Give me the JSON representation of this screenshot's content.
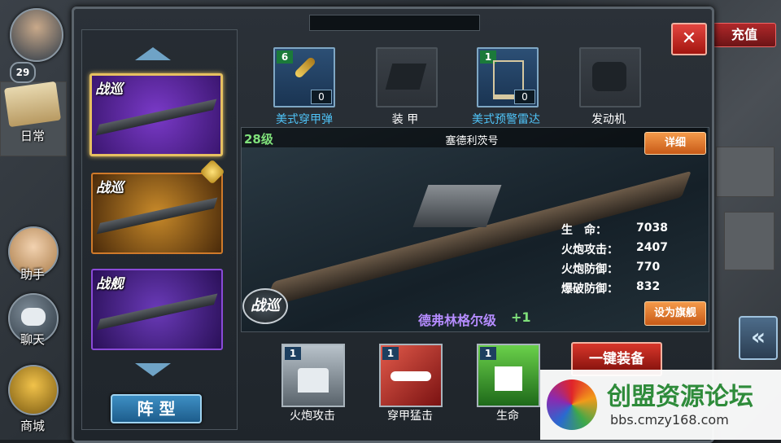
{
  "player": {
    "level": "29"
  },
  "side_menu": [
    {
      "label": "日常",
      "icon": "scroll-icon"
    },
    {
      "label": "助手",
      "icon": "assistant-girl-icon"
    },
    {
      "label": "聊天",
      "icon": "chat-bubble-icon"
    },
    {
      "label": "商城",
      "icon": "treasure-chest-icon"
    }
  ],
  "top_right": {
    "recharge_label": "充值",
    "close_label": "✕"
  },
  "ship_list": [
    {
      "badge": "战巡",
      "color": "#5a2a9a",
      "selected": true
    },
    {
      "badge": "战巡",
      "color": "#8a5a1a",
      "flagship": true
    },
    {
      "badge": "战舰",
      "color": "#4a2a86"
    }
  ],
  "formation_button": "阵 型",
  "equipment": [
    {
      "label": "美式穿甲弹",
      "level": "6",
      "count": "0",
      "active": true
    },
    {
      "label": "装 甲",
      "active": false
    },
    {
      "label": "美式预警雷达",
      "level": "1",
      "count": "0",
      "active": true
    },
    {
      "label": "发动机",
      "active": false
    }
  ],
  "ship": {
    "level": "28级",
    "name": "塞德利茨号",
    "detail_button": "详细",
    "class_badge": "战巡",
    "class_name": "德弗林格尔级",
    "class_bonus": "+1",
    "flagship_button": "设为旗舰",
    "stats": [
      {
        "label": "生　命：",
        "value": "7038"
      },
      {
        "label": "火炮攻击：",
        "value": "2407"
      },
      {
        "label": "火炮防御：",
        "value": "770"
      },
      {
        "label": "爆破防御：",
        "value": "832"
      }
    ]
  },
  "skills": [
    {
      "label": "火炮攻击",
      "level": "1",
      "color": "#8a9aa6"
    },
    {
      "label": "穿甲猛击",
      "level": "1",
      "color": "#b52a2a"
    },
    {
      "label": "生命",
      "level": "1",
      "color": "#3f9a2e"
    }
  ],
  "equip_all_button": "一键装备",
  "watermark": {
    "title": "创盟资源论坛",
    "url": "bbs.cmzy168.com"
  }
}
